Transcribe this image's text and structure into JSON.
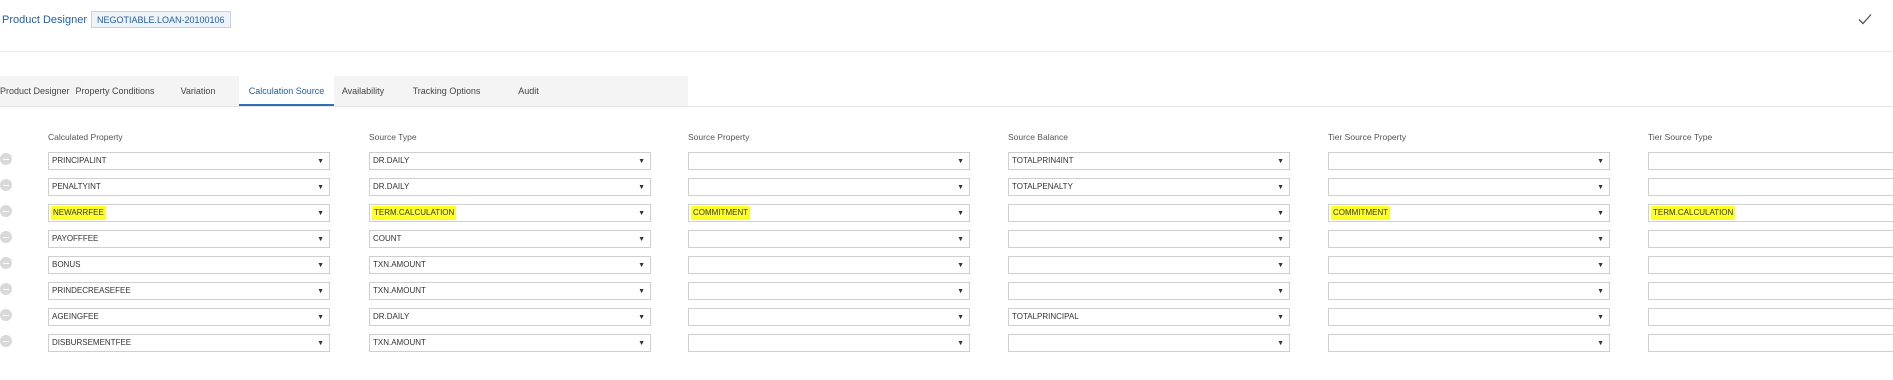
{
  "header": {
    "title": "Product Designer",
    "record_id": "NEGOTIABLE.LOAN-20100106"
  },
  "tabs": [
    {
      "label": "Product Designer",
      "active": false
    },
    {
      "label": "Property Conditions",
      "active": false
    },
    {
      "label": "Variation",
      "active": false
    },
    {
      "label": "Calculation Source",
      "active": true
    },
    {
      "label": "Availability",
      "active": false
    },
    {
      "label": "Tracking Options",
      "active": false
    },
    {
      "label": "Audit",
      "active": false
    }
  ],
  "columns": [
    "Calculated Property",
    "Source Type",
    "Source Property",
    "Source Balance",
    "Tier Source Property",
    "Tier Source Type"
  ],
  "highlight_color": "#ffff26",
  "accent_color": "#1f5fa8",
  "icons": {
    "save": "checkmark-icon",
    "remove": "minus-circle-icon",
    "dropdown": "dropdown-arrow-icon"
  },
  "rows": [
    {
      "calculated_property": "PRINCIPALINT",
      "source_type": "DR.DAILY",
      "source_property": "",
      "source_balance": "TOTALPRIN4INT",
      "tier_source_property": "",
      "tier_source_type": "",
      "highlighted": false
    },
    {
      "calculated_property": "PENALTYINT",
      "source_type": "DR.DAILY",
      "source_property": "",
      "source_balance": "TOTALPENALTY",
      "tier_source_property": "",
      "tier_source_type": "",
      "highlighted": false
    },
    {
      "calculated_property": "NEWARRFEE",
      "source_type": "TERM.CALCULATION",
      "source_property": "COMMITMENT",
      "source_balance": "",
      "tier_source_property": "COMMITMENT",
      "tier_source_type": "TERM.CALCULATION",
      "highlighted": true
    },
    {
      "calculated_property": "PAYOFFFEE",
      "source_type": "COUNT",
      "source_property": "",
      "source_balance": "",
      "tier_source_property": "",
      "tier_source_type": "",
      "highlighted": false
    },
    {
      "calculated_property": "BONUS",
      "source_type": "TXN.AMOUNT",
      "source_property": "",
      "source_balance": "",
      "tier_source_property": "",
      "tier_source_type": "",
      "highlighted": false
    },
    {
      "calculated_property": "PRINDECREASEFEE",
      "source_type": "TXN.AMOUNT",
      "source_property": "",
      "source_balance": "",
      "tier_source_property": "",
      "tier_source_type": "",
      "highlighted": false
    },
    {
      "calculated_property": "AGEINGFEE",
      "source_type": "DR.DAILY",
      "source_property": "",
      "source_balance": "TOTALPRINCIPAL",
      "tier_source_property": "",
      "tier_source_type": "",
      "highlighted": false
    },
    {
      "calculated_property": "DISBURSEMENTFEE",
      "source_type": "TXN.AMOUNT",
      "source_property": "",
      "source_balance": "",
      "tier_source_property": "",
      "tier_source_type": "",
      "highlighted": false
    }
  ]
}
